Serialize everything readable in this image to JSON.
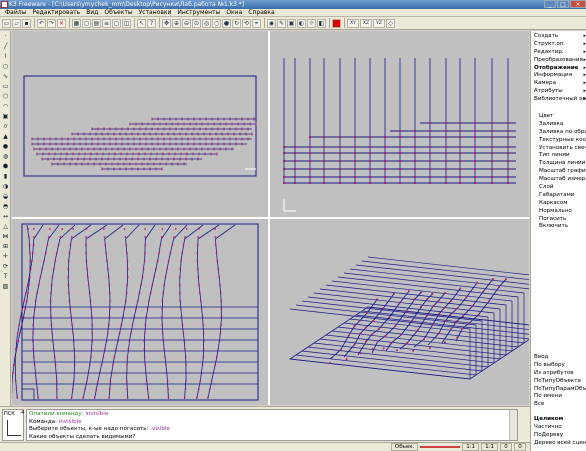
{
  "window": {
    "title": "K3 Freeware - [C:\\Users\\ymychek_mm\\Desktop\\Рисунки\\Лаб.работа №1.k3 *]"
  },
  "menu": [
    "Файлы",
    "Редактировать",
    "Вид",
    "Объекты",
    "Установки",
    "Инструменты",
    "Окна",
    "Справка"
  ],
  "toolbar": {
    "xy_label": "XY",
    "xz_label": "XZ",
    "yz_label": "YZ"
  },
  "right_panel": {
    "top_items": [
      {
        "label": "Создать",
        "arrow": true
      },
      {
        "label": "Структ.оп.",
        "arrow": true
      },
      {
        "label": "Редактир.",
        "arrow": true
      },
      {
        "label": "Преобразования",
        "arrow": true
      },
      {
        "label": "Отображение",
        "arrow": true,
        "bold": true
      },
      {
        "label": "Информация",
        "arrow": true
      },
      {
        "label": "Камера",
        "arrow": true
      },
      {
        "label": "Атрибуты",
        "arrow": true
      },
      {
        "label": "Библиотечный эл.",
        "arrow": true
      }
    ],
    "sub_items": [
      "Цвет",
      "Заливка",
      "Заливка по обра...",
      "Текстурные коо...",
      "Установить свеч...",
      "Тип линии",
      "Толщина линии",
      "Масштаб графи...",
      "Масштаб измер...",
      "Слой",
      "Габаритами",
      "Каркасом",
      "Нормально",
      "Погасить",
      "Включить"
    ],
    "select_items": [
      "Ввод",
      "По выбору",
      "Из атрибутов",
      "ПоТипуОбъекта",
      "ПоТипуПарамОбъ...",
      "По имени",
      "Все"
    ],
    "mode_items": [
      "Целиком",
      "Частично",
      "ПоДереву",
      "Дерево всей сцены"
    ]
  },
  "command": {
    "tag": "ПСК",
    "line_number": "4",
    "lines": [
      {
        "prefix": "Опатили команду: ",
        "value": "invisible"
      },
      {
        "prefix": "Команда: ",
        "value": "invisible"
      },
      {
        "prefix": "Выберите объекты, к-ые надо погасить: ",
        "value": ".visible"
      },
      {
        "prefix": "Какие объекты сделать видимыми?",
        "value": ""
      }
    ]
  },
  "status": {
    "mode": "Обьек.",
    "v1": "1:1",
    "v2": "1:1",
    "v3": "0",
    "v4": "0"
  },
  "colors": {
    "viewport_bg": "#c0c0c0",
    "lines": "#1a1a8c",
    "points": "#b0206c",
    "active_text": "#1c8a1c",
    "value_text": "#9a2f9a"
  }
}
